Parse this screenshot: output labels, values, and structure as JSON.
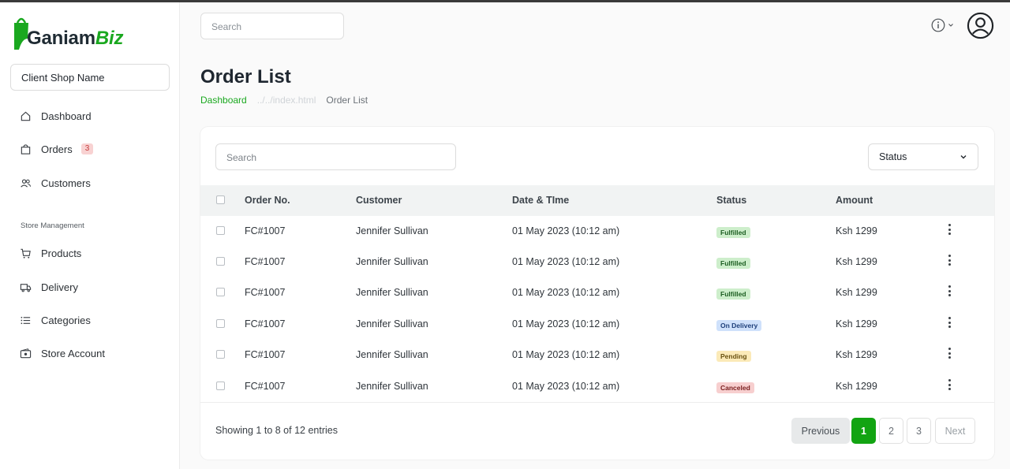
{
  "brand": {
    "name_part1": "Ganiam",
    "name_part2": "Biz",
    "accent": "#1aa81f"
  },
  "sidebar": {
    "shop_name": "Client Shop Name",
    "items": [
      {
        "label": "Dashboard",
        "icon": "home-icon"
      },
      {
        "label": "Orders",
        "icon": "bag-icon",
        "badge": "3"
      },
      {
        "label": "Customers",
        "icon": "users-icon"
      }
    ],
    "section_title": "Store Management",
    "store_items": [
      {
        "label": "Products",
        "icon": "cart-icon"
      },
      {
        "label": "Delivery",
        "icon": "truck-icon"
      },
      {
        "label": "Categories",
        "icon": "list-icon"
      },
      {
        "label": "Store Account",
        "icon": "wallet-icon"
      }
    ]
  },
  "header": {
    "search_placeholder": "Search"
  },
  "page": {
    "title": "Order List",
    "breadcrumb": {
      "home": "Dashboard",
      "middle": "../../index.html",
      "current": "Order List"
    }
  },
  "table": {
    "search_placeholder": "Search",
    "status_filter": "Status",
    "columns": [
      "Order No.",
      "Customer",
      "Date & TIme",
      "Status",
      "Amount"
    ],
    "rows": [
      {
        "order": "FC#1007",
        "customer": "Jennifer Sullivan",
        "date": "01 May 2023 (10:12 am)",
        "status": "Fulfilled",
        "status_type": "fulfilled",
        "amount": "Ksh 1299"
      },
      {
        "order": "FC#1007",
        "customer": "Jennifer Sullivan",
        "date": "01 May 2023 (10:12 am)",
        "status": "Fulfilled",
        "status_type": "fulfilled",
        "amount": "Ksh 1299"
      },
      {
        "order": "FC#1007",
        "customer": "Jennifer Sullivan",
        "date": "01 May 2023 (10:12 am)",
        "status": "Fulfilled",
        "status_type": "fulfilled",
        "amount": "Ksh 1299"
      },
      {
        "order": "FC#1007",
        "customer": "Jennifer Sullivan",
        "date": "01 May 2023 (10:12 am)",
        "status": "On Delivery",
        "status_type": "delivery",
        "amount": "Ksh 1299"
      },
      {
        "order": "FC#1007",
        "customer": "Jennifer Sullivan",
        "date": "01 May 2023 (10:12 am)",
        "status": "Pending",
        "status_type": "pending",
        "amount": "Ksh 1299"
      },
      {
        "order": "FC#1007",
        "customer": "Jennifer Sullivan",
        "date": "01 May 2023 (10:12 am)",
        "status": "Canceled",
        "status_type": "canceled",
        "amount": "Ksh 1299"
      }
    ],
    "showing": "Showing 1 to 8 of 12 entries",
    "pagination": {
      "previous": "Previous",
      "pages": [
        "1",
        "2",
        "3"
      ],
      "next": "Next",
      "current": "1"
    }
  }
}
